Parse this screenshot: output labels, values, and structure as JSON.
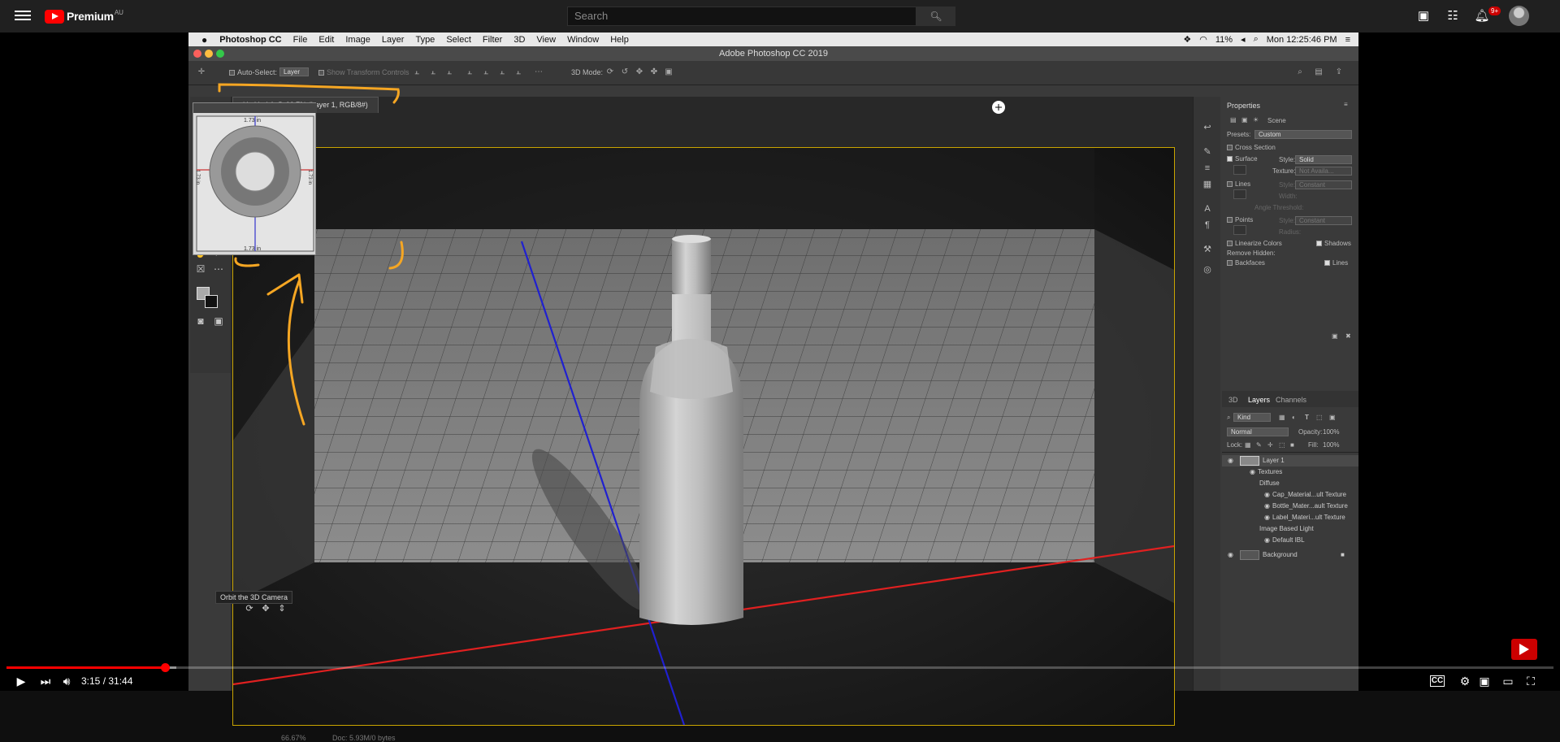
{
  "youtube": {
    "logo_text": "Premium",
    "region": "AU",
    "search_placeholder": "Search",
    "notification_count": "9+",
    "time_display": "3:15 / 31:44",
    "progress": {
      "played_fraction": 0.1022,
      "loaded_fraction": 0.11
    }
  },
  "mac": {
    "app_name": "Photoshop CC",
    "menus": [
      "File",
      "Edit",
      "Image",
      "Layer",
      "Type",
      "Select",
      "Filter",
      "3D",
      "View",
      "Window",
      "Help"
    ],
    "battery": "11%",
    "clock": "Mon 12:25:46 PM"
  },
  "ps": {
    "window_title": "Adobe Photoshop CC 2019",
    "options": {
      "auto_select_label": "Auto-Select:",
      "auto_select_value": "Layer",
      "transform_label": "Show Transform Controls",
      "mode_label": "3D Mode:"
    },
    "doc_tab": "Untitled-1 @ 66.7% (Layer 1, RGB/8#)",
    "zoom": "66.67%",
    "doc_size": "Doc: 5.93M/0 bytes",
    "camera_tooltip": "Orbit the 3D Camera",
    "navigator": {
      "ruler_top": "1.73 in",
      "ruler_bottom": "1.73 in",
      "ruler_left": "1.73 in",
      "ruler_right": "1.73 in"
    },
    "properties": {
      "title": "Properties",
      "scene_label": "Scene",
      "presets_label": "Presets:",
      "presets_value": "Custom",
      "cross_section": "Cross Section",
      "surface": "Surface",
      "style_label": "Style:",
      "surface_style": "Solid",
      "texture_label": "Texture:",
      "texture_value": "Not Availa...",
      "lines": "Lines",
      "lines_style": "Constant",
      "width_label": "Width:",
      "angle_label": "Angle Threshold:",
      "points": "Points",
      "points_style": "Constant",
      "radius_label": "Radius:",
      "linearize": "Linearize Colors",
      "shadows": "Shadows",
      "remove_hidden": "Remove Hidden:",
      "backfaces": "Backfaces",
      "lines_hidden": "Lines"
    },
    "layers": {
      "tabs": [
        "3D",
        "Layers",
        "Channels"
      ],
      "kind": "Kind",
      "blend": "Normal",
      "opacity_label": "Opacity:",
      "opacity": "100%",
      "lock_label": "Lock:",
      "fill_label": "Fill:",
      "fill": "100%",
      "rows": [
        "Layer 1",
        "Textures",
        "Diffuse",
        "Cap_Material...ult Texture",
        "Bottle_Mater...ault Texture",
        "Label_Materi...ult Texture",
        "Image Based Light",
        "Default IBL",
        "Background"
      ]
    }
  }
}
